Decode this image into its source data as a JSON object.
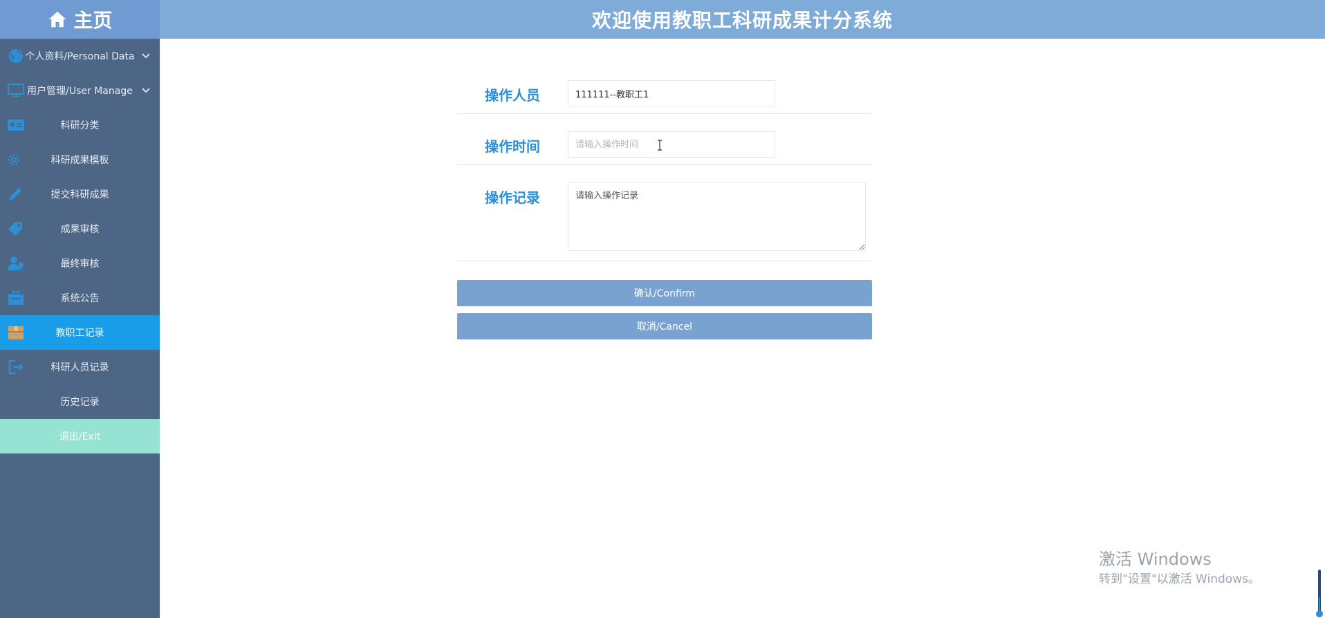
{
  "sidebar": {
    "home_label": "主页",
    "items": [
      {
        "label": "个人资料/Personal Data",
        "icon": "globe-icon",
        "has_chevron": true
      },
      {
        "label": "用户管理/User Manage",
        "icon": "monitor-icon",
        "has_chevron": true
      },
      {
        "label": "科研分类",
        "icon": "id-card-icon"
      },
      {
        "label": "科研成果模板",
        "icon": "gear-icon"
      },
      {
        "label": "提交科研成果",
        "icon": "pencil-icon"
      },
      {
        "label": "成果审核",
        "icon": "tag-icon"
      },
      {
        "label": "最终审核",
        "icon": "user-shield-icon"
      },
      {
        "label": "系统公告",
        "icon": "briefcase-icon"
      },
      {
        "label": "教职工记录",
        "icon": "box-icon",
        "active": true
      },
      {
        "label": "科研人员记录",
        "icon": "sign-out-icon"
      },
      {
        "label": "历史记录"
      },
      {
        "label": "退出/Exit",
        "exit": true
      }
    ]
  },
  "header": {
    "title": "欢迎使用教职工科研成果计分系统"
  },
  "form": {
    "operator_label": "操作人员",
    "operator_value": "111111--教职工1",
    "time_label": "操作时间",
    "time_placeholder": "请输入操作时间",
    "record_label": "操作记录",
    "record_placeholder": "请输入操作记录"
  },
  "buttons": {
    "confirm": "确认/Confirm",
    "cancel": "取消/Cancel"
  },
  "watermark": {
    "line1": "激活 Windows",
    "line2": "转到\"设置\"以激活 Windows。"
  },
  "colors": {
    "sidebar": "#4e6685",
    "header": "#7fabd9",
    "home": "#6f9ad2",
    "active": "#1a9de8",
    "exit": "#96e3d4",
    "label": "#2d8fd5",
    "button": "#7aa2d0"
  }
}
